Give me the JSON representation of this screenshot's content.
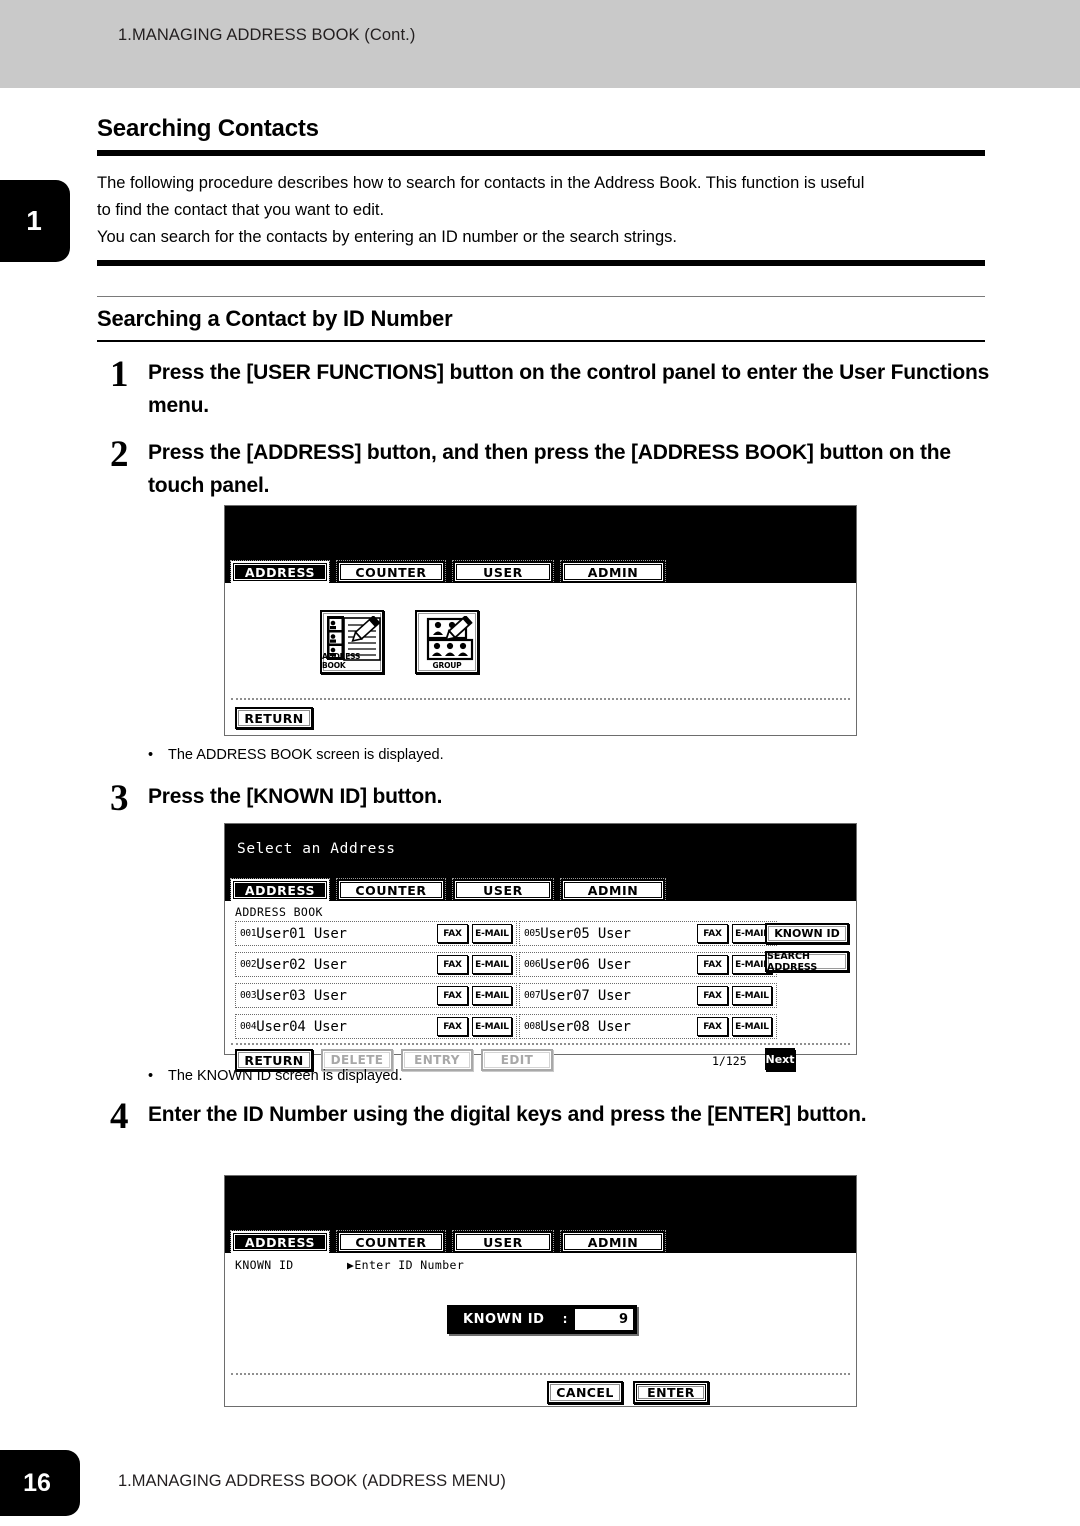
{
  "header": {
    "running_head": "1.MANAGING ADDRESS BOOK (Cont.)"
  },
  "chapter_tab": {
    "number": "1"
  },
  "section": {
    "title": "Searching Contacts",
    "intro_line1": "The following procedure describes how to search for contacts in the Address Book.  This function is useful",
    "intro_line2": "to find the contact that you want to edit.",
    "intro_line3": "You can search for the contacts by entering an ID number or the search strings.",
    "subtitle": "Searching a Contact by ID Number"
  },
  "steps": [
    {
      "number": "1",
      "text": "Press the [USER FUNCTIONS] button on the control panel to enter the User Functions menu."
    },
    {
      "number": "2",
      "text": "Press the [ADDRESS] button, and then press the [ADDRESS BOOK] button on the touch panel."
    },
    {
      "number": "3",
      "text": "Press the [KNOWN ID] button."
    },
    {
      "number": "4",
      "text": "Enter the ID Number using the digital keys and press the [ENTER] button."
    }
  ],
  "notes": {
    "note1": "The ADDRESS BOOK screen is displayed.",
    "note2": "The KNOWN ID screen is displayed.",
    "bullet_char": "•"
  },
  "panel1": {
    "title": "",
    "tabs": [
      {
        "label": "ADDRESS",
        "state": "active"
      },
      {
        "label": "COUNTER",
        "state": "inactive"
      },
      {
        "label": "USER",
        "state": "inactive"
      },
      {
        "label": "ADMIN",
        "state": "inactive"
      }
    ],
    "icons": [
      {
        "caption": "ADDRESS BOOK",
        "icon": "address-book-icon"
      },
      {
        "caption": "GROUP",
        "icon": "group-icon"
      }
    ],
    "return_label": "RETURN"
  },
  "panel2": {
    "title": "Select an Address",
    "tabs": [
      {
        "label": "ADDRESS",
        "state": "active"
      },
      {
        "label": "COUNTER",
        "state": "inactive"
      },
      {
        "label": "USER",
        "state": "inactive"
      },
      {
        "label": "ADMIN",
        "state": "inactive"
      }
    ],
    "list_header": "ADDRESS BOOK",
    "col_fax": "FAX",
    "col_email": "E-MAIL",
    "entries_left": [
      {
        "id": "001",
        "name": "User01 User"
      },
      {
        "id": "002",
        "name": "User02 User"
      },
      {
        "id": "003",
        "name": "User03 User"
      },
      {
        "id": "004",
        "name": "User04 User"
      }
    ],
    "entries_right": [
      {
        "id": "005",
        "name": "User05 User"
      },
      {
        "id": "006",
        "name": "User06 User"
      },
      {
        "id": "007",
        "name": "User07 User"
      },
      {
        "id": "008",
        "name": "User08 User"
      }
    ],
    "side_buttons": [
      {
        "label": "KNOWN ID",
        "state": "enabled"
      },
      {
        "label": "SEARCH ADDRESS",
        "state": "enabled"
      }
    ],
    "toolbar": [
      {
        "label": "RETURN",
        "state": "enabled"
      },
      {
        "label": "DELETE",
        "state": "disabled"
      },
      {
        "label": "ENTRY",
        "state": "disabled"
      },
      {
        "label": "EDIT",
        "state": "disabled"
      }
    ],
    "page_indicator": "1/125",
    "next_label": "Next"
  },
  "panel3": {
    "title": "",
    "tabs": [
      {
        "label": "ADDRESS",
        "state": "active"
      },
      {
        "label": "COUNTER",
        "state": "inactive"
      },
      {
        "label": "USER",
        "state": "inactive"
      },
      {
        "label": "ADMIN",
        "state": "inactive"
      }
    ],
    "mode_label": "KNOWN ID",
    "prompt": "▶Enter ID Number",
    "field": {
      "label": "KNOWN ID",
      "separator": ":",
      "value": "9"
    },
    "cancel_label": "CANCEL",
    "enter_label": "ENTER"
  },
  "footer": {
    "page_number": "16",
    "running_foot": "1.MANAGING ADDRESS BOOK (ADDRESS MENU)"
  }
}
